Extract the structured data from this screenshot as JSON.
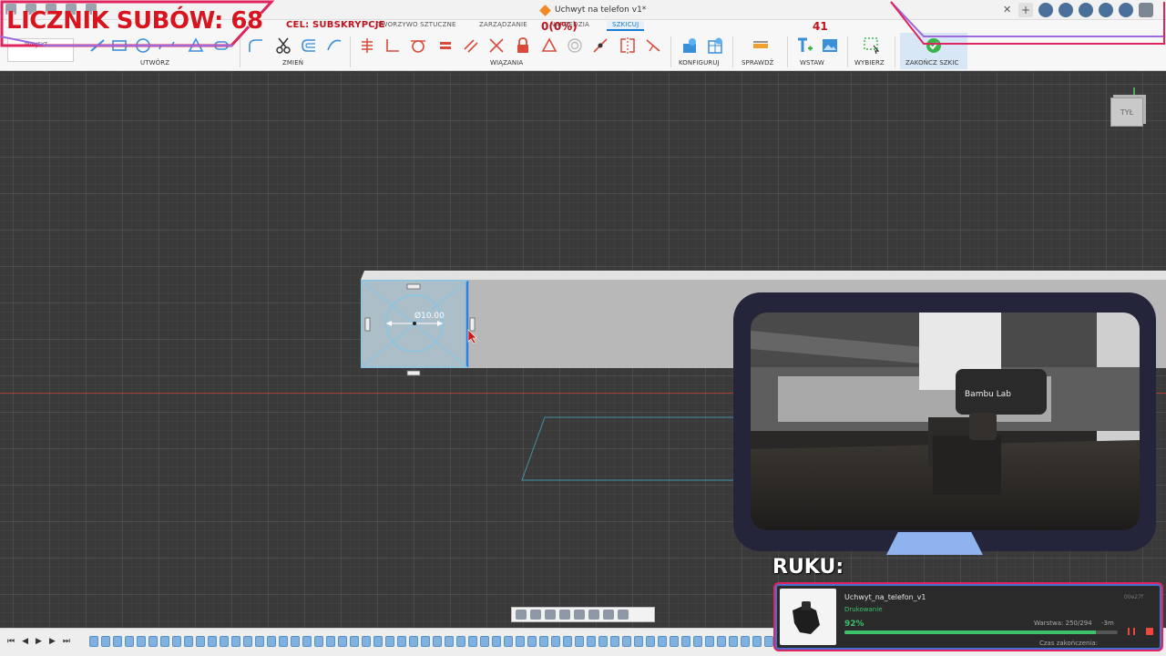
{
  "window": {
    "document_title": "Uchwyt na telefon v1*"
  },
  "tabs": [
    {
      "label": "TWORZYWO SZTUCZNE"
    },
    {
      "label": "ZARZĄDZANIE"
    },
    {
      "label": "NARZĘDZIA"
    },
    {
      "label": "SZKICUJ"
    }
  ],
  "toolbar": {
    "project_label": "PROJEKT",
    "groups": {
      "create": "UTWÓRZ",
      "modify": "ZMIEŃ",
      "constraints": "WIĄZANIA",
      "configure": "KONFIGURUJ",
      "inspect": "SPRAWDŹ",
      "insert": "WSTAW",
      "select": "WYBIERZ",
      "finish": "ZAKOŃCZ SZKIC"
    }
  },
  "viewport": {
    "dimension_label": "Ø10.00",
    "viewcube_face": "TYŁ"
  },
  "overlay": {
    "sub_counter": "LICZNIK SUBÓW: 68",
    "goal_text": "CEL: SUBSKRYPCJE",
    "goal_progress": "0(0%)",
    "goal_number": "41",
    "ruku_label": "RUKU:",
    "camera_brand": "Bambu Lab"
  },
  "printer": {
    "file_name": "Uchwyt_na_telefon_v1",
    "status": "Drukowanie",
    "printer_id": "00e27f",
    "percent_label": "92%",
    "progress": 0.92,
    "layer": "Warstwa: 250/294",
    "remaining": "-3m",
    "finish_label": "Czas zakończenia:"
  },
  "colors": {
    "accent_blue": "#1a7ccf",
    "overlay_red": "#d8141e",
    "overlay_pink": "#e0245e",
    "overlay_purple": "#9b6bdc",
    "progress_green": "#3cc36b",
    "sketch_cyan": "#4cc6ee"
  }
}
